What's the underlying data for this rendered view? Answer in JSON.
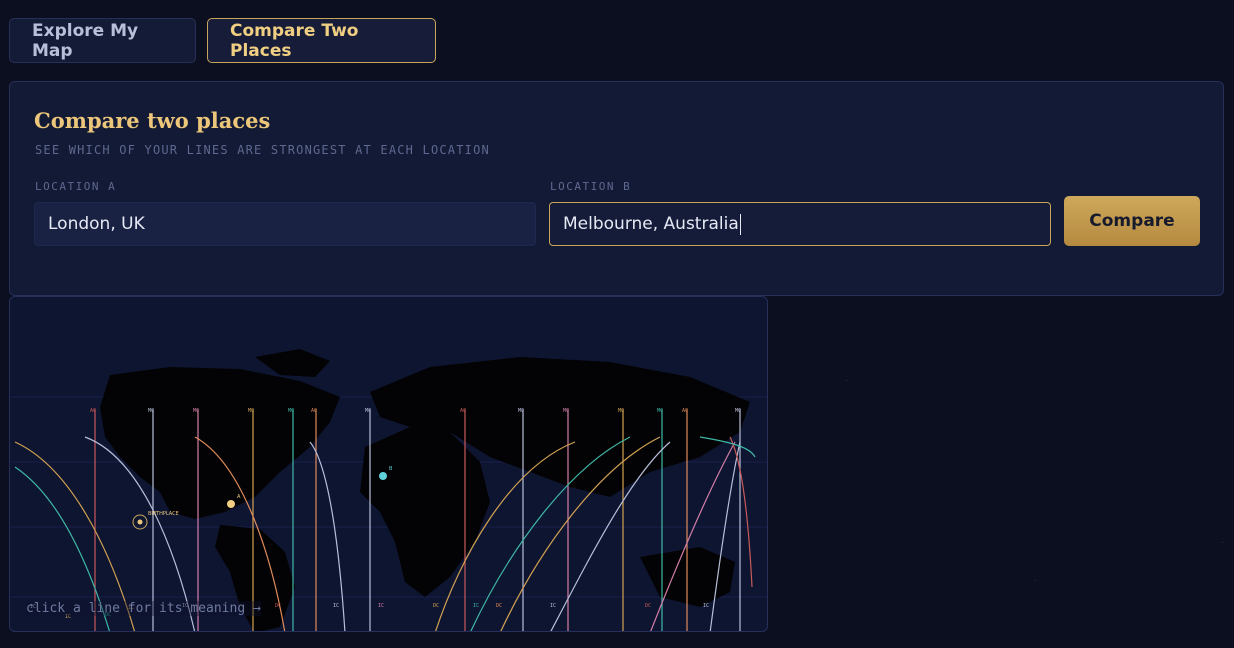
{
  "tabs": [
    {
      "label": "Explore My Map",
      "active": false
    },
    {
      "label": "Compare Two Places",
      "active": true
    }
  ],
  "compare": {
    "title": "Compare two places",
    "subtitle": "SEE WHICH OF YOUR LINES ARE STRONGEST AT EACH LOCATION",
    "location_a": {
      "label": "LOCATION A",
      "value": "London, UK"
    },
    "location_b": {
      "label": "LOCATION B",
      "value": "Melbourne, Australia"
    },
    "button_label": "Compare"
  },
  "map": {
    "hint": "click a line for its meaning →",
    "birthplace_label": "BIRTHPLACE",
    "marker_a_label": "A",
    "marker_b_label": "B",
    "line_labels_top": [
      "AC",
      "MC",
      "MC",
      "MC",
      "MC",
      "AC",
      "MC",
      "AC",
      "MC",
      "MC",
      "MC",
      "MC",
      "AC",
      "MC"
    ],
    "line_labels_bottom": [
      "DC",
      "IC",
      "IC",
      "DC",
      "IC",
      "DC",
      "IC",
      "DC",
      "IC",
      "IC",
      "IC",
      "IC",
      "DC",
      "IC"
    ]
  },
  "colors": {
    "accent": "#c9a55c",
    "background": "#0b0f20",
    "panel": "#131a35"
  }
}
